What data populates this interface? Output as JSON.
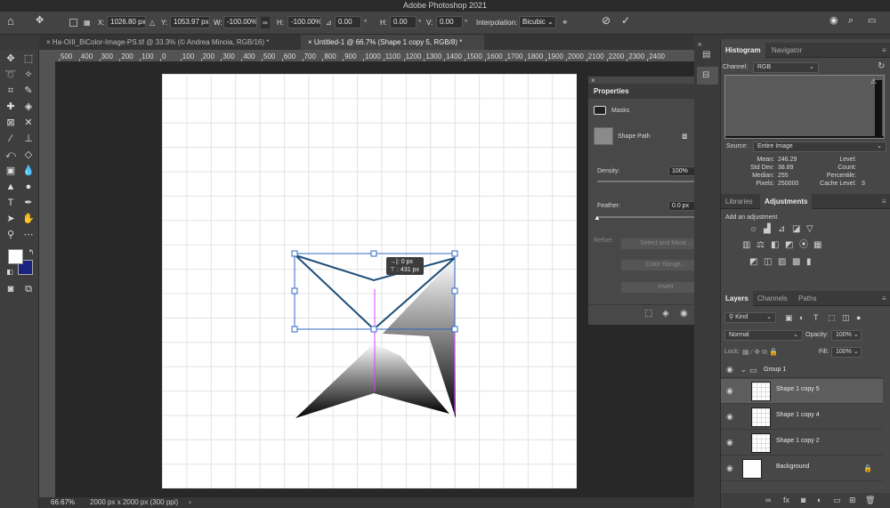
{
  "app": {
    "title": "Adobe Photoshop 2021"
  },
  "options": {
    "x_label": "X:",
    "x_value": "1026.80 px",
    "y_label": "Y:",
    "y_value": "1053.97 px",
    "w_label": "W:",
    "w_value": "-100.00%",
    "h_label": "H:",
    "h_value": "-100.00%",
    "angle_value": "0.00",
    "degree": "°",
    "hskew_label": "H:",
    "hskew_value": "0.00",
    "vskew_label": "V:",
    "vskew_value": "0.00",
    "interp_label": "Interpolation:",
    "interp_value": "Bicubic"
  },
  "tabs": [
    {
      "label": "Ha-OIII_BiColor-Image-PS.tif @ 33.3% (© Andrea Minoia, RGB/16) *"
    },
    {
      "label": "Untitled-1 @ 66.7% (Shape 1 copy 5, RGB/8) *"
    }
  ],
  "ruler": {
    "ticks": [
      "500",
      "400",
      "300",
      "200",
      "100",
      "0",
      "100",
      "200",
      "300",
      "400",
      "500",
      "600",
      "700",
      "800",
      "900",
      "1000",
      "1100",
      "1200",
      "1300",
      "1400",
      "1500",
      "1600",
      "1700",
      "1800",
      "1900",
      "2000",
      "2100",
      "2200",
      "2300",
      "2400"
    ]
  },
  "tooltip": {
    "line1": "→|:    0 px",
    "line2": "⊤ : 431 px"
  },
  "status": {
    "zoom": "66.67%",
    "docsize": "2000 px x 2000 px (300 ppi)",
    "arrow": "›"
  },
  "properties": {
    "title": "Properties",
    "masks": "Masks",
    "shape_path": "Shape Path",
    "density_label": "Density:",
    "density_value": "100%",
    "feather_label": "Feather:",
    "feather_value": "0.0 px",
    "refine_label": "Refine:",
    "select_mask": "Select and Mask...",
    "color_range": "Color Range...",
    "invert": "Invert"
  },
  "histogram": {
    "tabs": [
      "Histogram",
      "Navigator"
    ],
    "channel_label": "Channel:",
    "channel_value": "RGB",
    "source_label": "Source:",
    "source_value": "Entire Image",
    "stats_left": [
      [
        "Mean:",
        "246.29"
      ],
      [
        "Std Dev:",
        "38.89"
      ],
      [
        "Median:",
        "255"
      ],
      [
        "Pixels:",
        "250000"
      ]
    ],
    "stats_right": [
      [
        "Level:",
        ""
      ],
      [
        "Count:",
        ""
      ],
      [
        "Percentile:",
        ""
      ],
      [
        "Cache Level:",
        "3"
      ]
    ]
  },
  "adjustments": {
    "tabs": [
      "Libraries",
      "Adjustments"
    ],
    "hint": "Add an adjustment"
  },
  "layers": {
    "tabs": [
      "Layers",
      "Channels",
      "Paths"
    ],
    "kind": "Kind",
    "blend": "Normal",
    "opacity_label": "Opacity:",
    "opacity_value": "100%",
    "lock_label": "Lock:",
    "fill_label": "Fill:",
    "fill_value": "100%",
    "group": "Group 1",
    "items": [
      {
        "name": "Shape 1 copy 5"
      },
      {
        "name": "Shape 1 copy 4"
      },
      {
        "name": "Shape 1 copy 2"
      },
      {
        "name": "Background"
      }
    ]
  },
  "colors": {
    "foreground": "#ffffff",
    "background": "#1a237e",
    "accent": "#2f68c4",
    "guide": "#e040fb",
    "path": "#1f4e79"
  }
}
